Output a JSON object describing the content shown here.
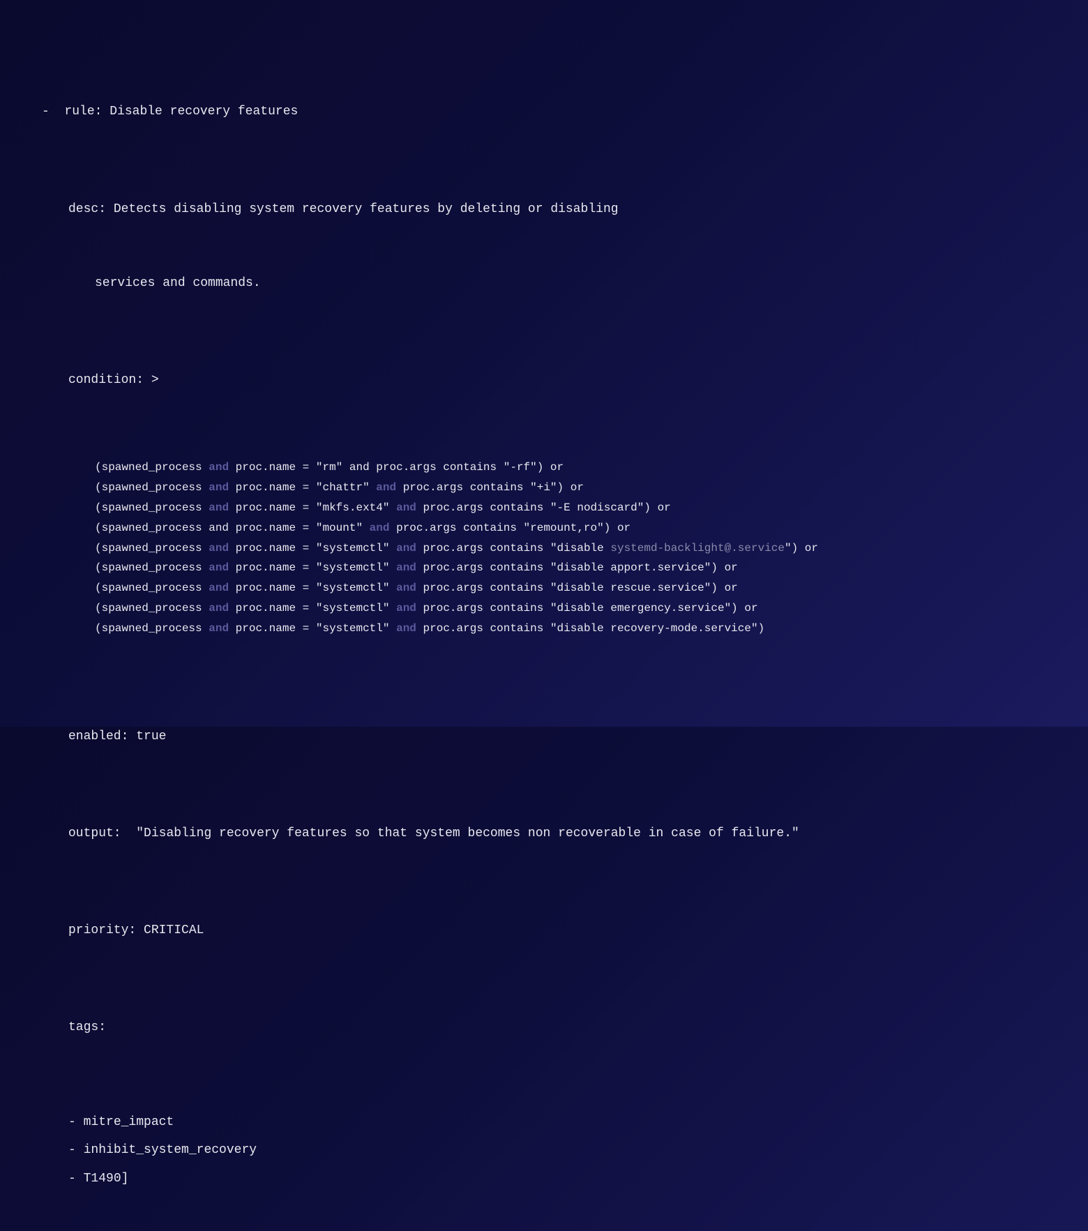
{
  "yaml": {
    "rule_key": "rule:",
    "rule_value": "Disable recovery features",
    "desc_key": "desc:",
    "desc_value_line1": "Detects disabling system recovery features by deleting or disabling",
    "desc_value_line2": "services and commands.",
    "condition_key": "condition: >",
    "condition_lines": [
      {
        "pre": "(spawned_process ",
        "and1_hl": true,
        "mid1": " proc.name = \"rm\" and proc.args contains \"-rf\") or",
        "and2_hl": false,
        "mid2": ""
      },
      {
        "pre": "(spawned_process ",
        "and1_hl": true,
        "mid1": " proc.name = \"chattr\" ",
        "and2_hl": true,
        "mid2": " proc.args contains \"+i\") or"
      },
      {
        "pre": "(spawned_process ",
        "and1_hl": true,
        "mid1": " proc.name = \"mkfs.ext4\" ",
        "and2_hl": true,
        "mid2": " proc.args contains \"-E nodiscard\") or"
      },
      {
        "pre": "(spawned_process and proc.name = \"mount\" ",
        "and1_hl": false,
        "mid1": "",
        "and2_hl": true,
        "mid2": " proc.args contains \"remount,ro\") or"
      },
      {
        "pre": "(spawned_process ",
        "and1_hl": true,
        "mid1": " proc.name = \"systemctl\" ",
        "and2_hl": true,
        "mid2": " proc.args contains \"disable ",
        "dim": "systemd-backlight@.service",
        "post": "\") or"
      },
      {
        "pre": "(spawned_process ",
        "and1_hl": true,
        "mid1": " proc.name = \"systemctl\" ",
        "and2_hl": true,
        "mid2": " proc.args contains \"disable apport.service\") or"
      },
      {
        "pre": "(spawned_process ",
        "and1_hl": true,
        "mid1": " proc.name = \"systemctl\" ",
        "and2_hl": true,
        "mid2": " proc.args contains \"disable rescue.service\") or"
      },
      {
        "pre": "(spawned_process ",
        "and1_hl": true,
        "mid1": " proc.name = \"systemctl\" ",
        "and2_hl": true,
        "mid2": " proc.args contains \"disable emergency.service\") or"
      },
      {
        "pre": "(spawned_process ",
        "and1_hl": true,
        "mid1": " proc.name = \"systemctl\" ",
        "and2_hl": true,
        "mid2": " proc.args contains \"disable recovery-mode.service\")"
      }
    ],
    "enabled_key": "enabled:",
    "enabled_value": "true",
    "output_key": "output:",
    "output_value": " \"Disabling recovery features so that system becomes non recoverable in case of failure.\"",
    "priority_key": "priority:",
    "priority_value": "CRITICAL",
    "tags_key": "tags:",
    "tags": [
      "mitre_impact",
      "inhibit_system_recovery",
      "T1490]"
    ],
    "dash": "-",
    "and_kw": "and"
  }
}
